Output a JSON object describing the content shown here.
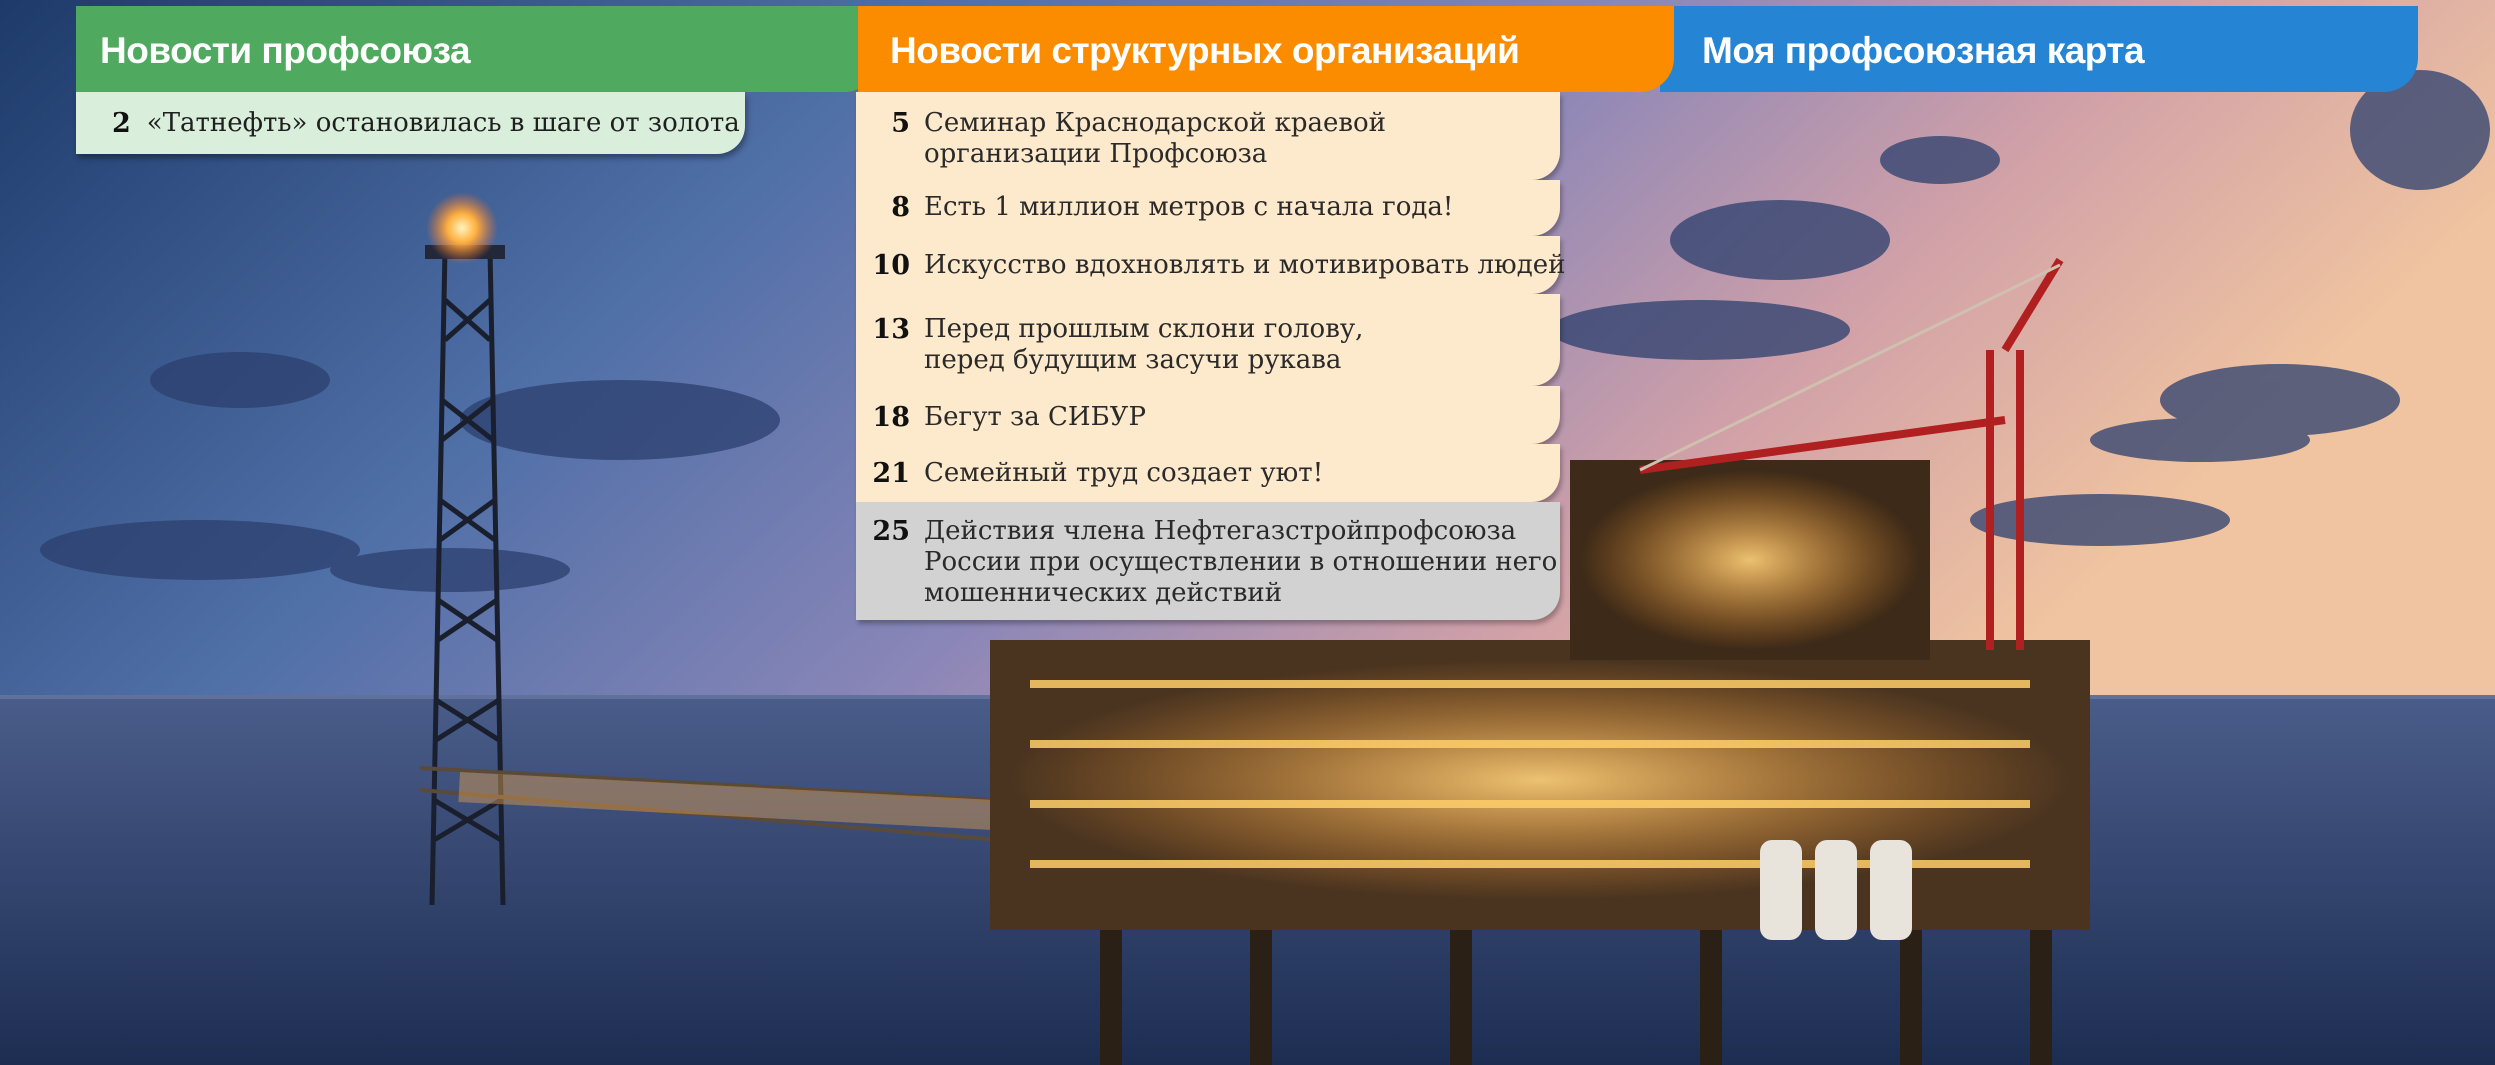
{
  "tabs": {
    "union_news": "Новости профсоюза",
    "structural_news": "Новости структурных организаций",
    "my_card": "Моя профсоюзная карта"
  },
  "union_news_items": [
    {
      "page": "2",
      "title": "«Татнефть» остановилась в шаге от золота"
    }
  ],
  "structural_items": [
    {
      "page": "5",
      "lines": [
        "Семинар Краснодарской краевой",
        "организации Профсоюза"
      ]
    },
    {
      "page": "8",
      "lines": [
        "Есть 1 миллион метров с начала года!"
      ]
    },
    {
      "page": "10",
      "lines": [
        "Искусство вдохновлять и мотивировать людей"
      ]
    },
    {
      "page": "13",
      "lines": [
        "Перед прошлым склони голову,",
        "перед будущим засучи рукава"
      ]
    },
    {
      "page": "18",
      "lines": [
        "Бегут за СИБУР"
      ]
    },
    {
      "page": "21",
      "lines": [
        "Семейный труд создает уют!"
      ]
    },
    {
      "page": "25",
      "lines": [
        "Действия члена Нефтегазстройпрофсоюза",
        "России при осуществлении в отношении него",
        "мошеннических действий"
      ]
    }
  ],
  "colors": {
    "union_tab": "#4faa60",
    "structural_tab": "#fb8c00",
    "card_tab": "#2585d4"
  },
  "background_image": "offshore-oil-platform-at-dusk"
}
